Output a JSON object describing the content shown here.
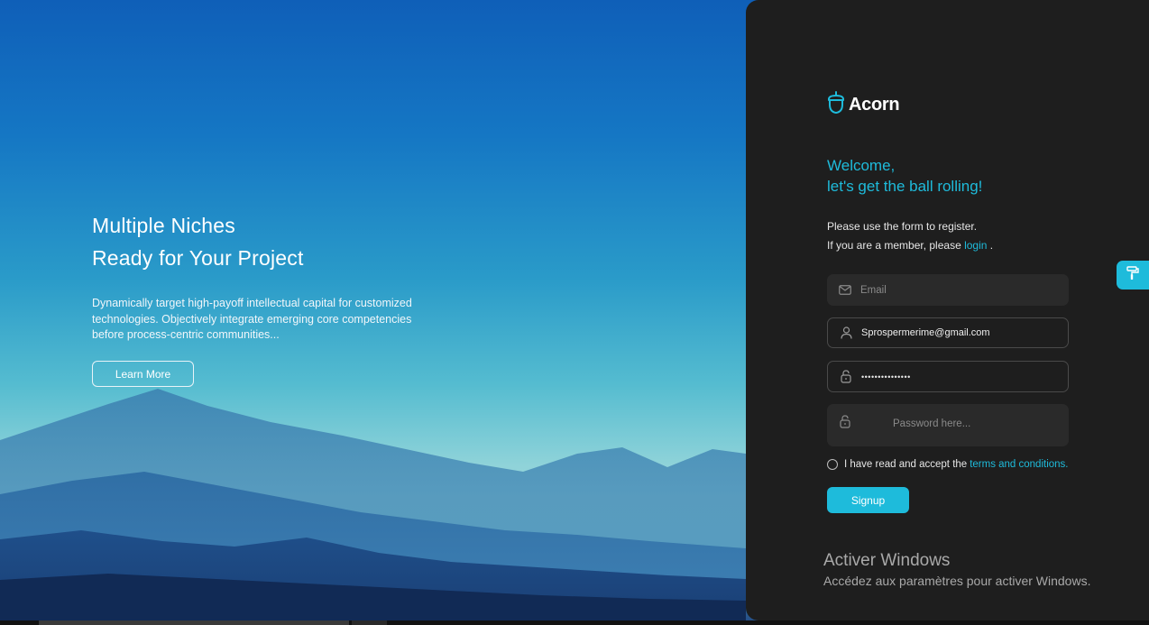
{
  "hero": {
    "title_line1": "Multiple Niches",
    "title_line2": "Ready for Your Project",
    "description": "Dynamically target high-payoff intellectual capital for customized technologies. Objectively integrate emerging core competencies before process-centric communities...",
    "learn_more_label": "Learn More"
  },
  "brand": {
    "name": "Acorn",
    "logo_icon": "acorn-icon",
    "accent_color": "#1ebbdb"
  },
  "panel": {
    "welcome_line1": "Welcome,",
    "welcome_line2": "let's get the ball rolling!",
    "intro_line1": "Please use the form to register.",
    "intro_line2_prefix": "If you are a member, please",
    "login_link": "login",
    "intro_line2_suffix": "."
  },
  "form": {
    "email_placeholder": "Email",
    "username_value": "Sprospermerime@gmail.com",
    "password_value": "•••••••••••••••",
    "password_confirm_placeholder": "Password here...",
    "terms_prefix": "I have read and accept the",
    "terms_link": "terms and conditions.",
    "signup_label": "Signup"
  },
  "windows_watermark": {
    "title": "Activer Windows",
    "subtitle": "Accédez aux paramètres pour activer Windows."
  },
  "side_tab": {
    "icon": "paint-roller-icon"
  }
}
